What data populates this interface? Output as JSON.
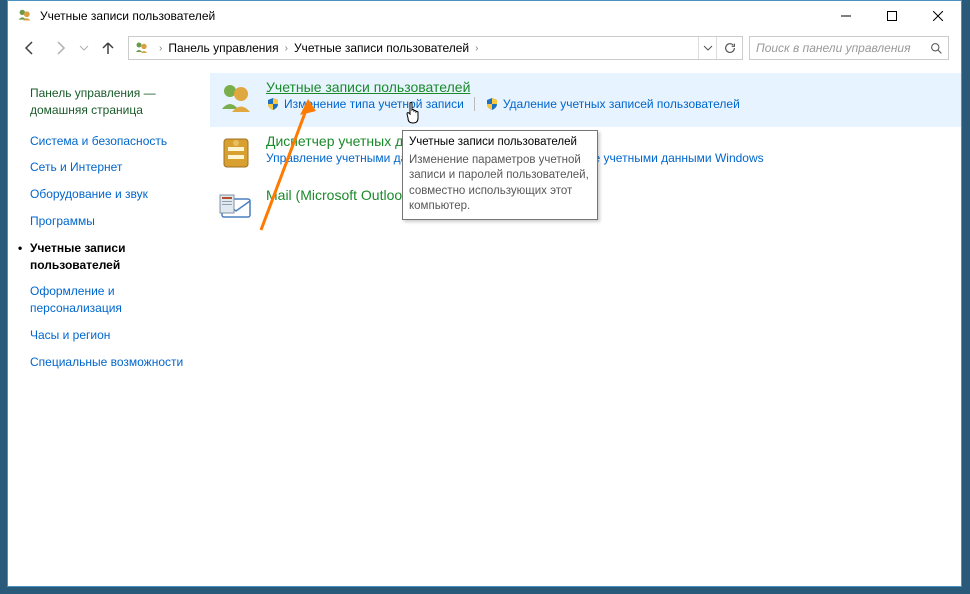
{
  "window": {
    "title": "Учетные записи пользователей"
  },
  "breadcrumb": {
    "cp": "Панель управления",
    "uac": "Учетные записи пользователей"
  },
  "search": {
    "placeholder": "Поиск в панели управления"
  },
  "sidebar": {
    "header": "Панель управления — домашняя страница",
    "items": [
      {
        "label": "Система и безопасность"
      },
      {
        "label": "Сеть и Интернет"
      },
      {
        "label": "Оборудование и звук"
      },
      {
        "label": "Программы"
      },
      {
        "label": "Учетные записи пользователей",
        "active": true
      },
      {
        "label": "Оформление и персонализация"
      },
      {
        "label": "Часы и регион"
      },
      {
        "label": "Специальные возможности"
      }
    ]
  },
  "main": {
    "cats": [
      {
        "title": "Учетные записи пользователей",
        "highlight": true,
        "underline": true,
        "subs": [
          {
            "label": "Изменение типа учетной записи",
            "shield": true
          },
          {
            "label": "Удаление учетных записей пользователей",
            "shield": true
          }
        ]
      },
      {
        "title": "Диспетчер учетных данных",
        "subs_single": "Управление учетными данными для Интернета    Управление учетными данными Windows"
      },
      {
        "title": "Mail (Microsoft Outlook)"
      }
    ]
  },
  "tooltip": {
    "title": "Учетные записи пользователей",
    "body": "Изменение параметров учетной записи и паролей пользователей, совместно использующих этот компьютер."
  }
}
